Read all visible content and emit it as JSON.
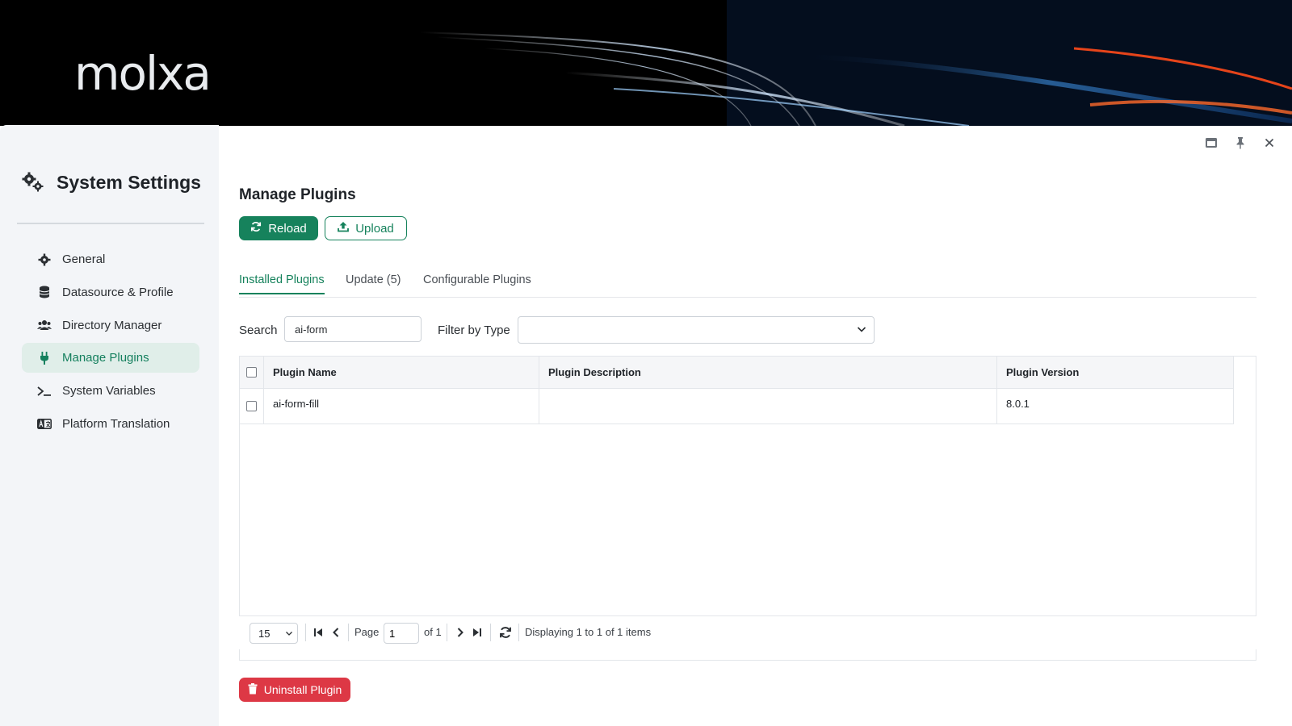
{
  "brand": {
    "logo_text": "molxa"
  },
  "sidebar": {
    "title": "System Settings",
    "title_icon": "gears-icon",
    "items": [
      {
        "label": "General",
        "icon": "gear-icon",
        "active": false
      },
      {
        "label": "Datasource & Profile",
        "icon": "database-icon",
        "active": false
      },
      {
        "label": "Directory Manager",
        "icon": "users-icon",
        "active": false
      },
      {
        "label": "Manage Plugins",
        "icon": "plug-icon",
        "active": true
      },
      {
        "label": "System Variables",
        "icon": "terminal-icon",
        "active": false
      },
      {
        "label": "Platform Translation",
        "icon": "language-icon",
        "active": false
      }
    ]
  },
  "window_controls": [
    "minimize-icon",
    "pin-icon",
    "close-icon"
  ],
  "main": {
    "title": "Manage Plugins",
    "reload_label": "Reload",
    "upload_label": "Upload",
    "tabs": [
      {
        "label": "Installed Plugins",
        "active": true
      },
      {
        "label": "Update (5)",
        "active": false
      },
      {
        "label": "Configurable Plugins",
        "active": false
      }
    ],
    "search_label": "Search",
    "search_value": "ai-form",
    "filter_label": "Filter by Type",
    "filter_value": "",
    "table": {
      "columns": [
        "Plugin Name",
        "Plugin Description",
        "Plugin Version"
      ],
      "rows": [
        {
          "name": "ai-form-fill",
          "description": "",
          "version": "8.0.1"
        }
      ]
    },
    "pager": {
      "page_size": "15",
      "page_label": "Page",
      "page_value": "1",
      "of_label": "of 1",
      "display_text": "Displaying 1 to 1 of 1 items"
    },
    "uninstall_label": "Uninstall Plugin"
  },
  "colors": {
    "accent": "#16825c",
    "danger": "#dd3845",
    "sidebar_bg": "#f3f5f8",
    "active_bg": "#e0eee9"
  }
}
